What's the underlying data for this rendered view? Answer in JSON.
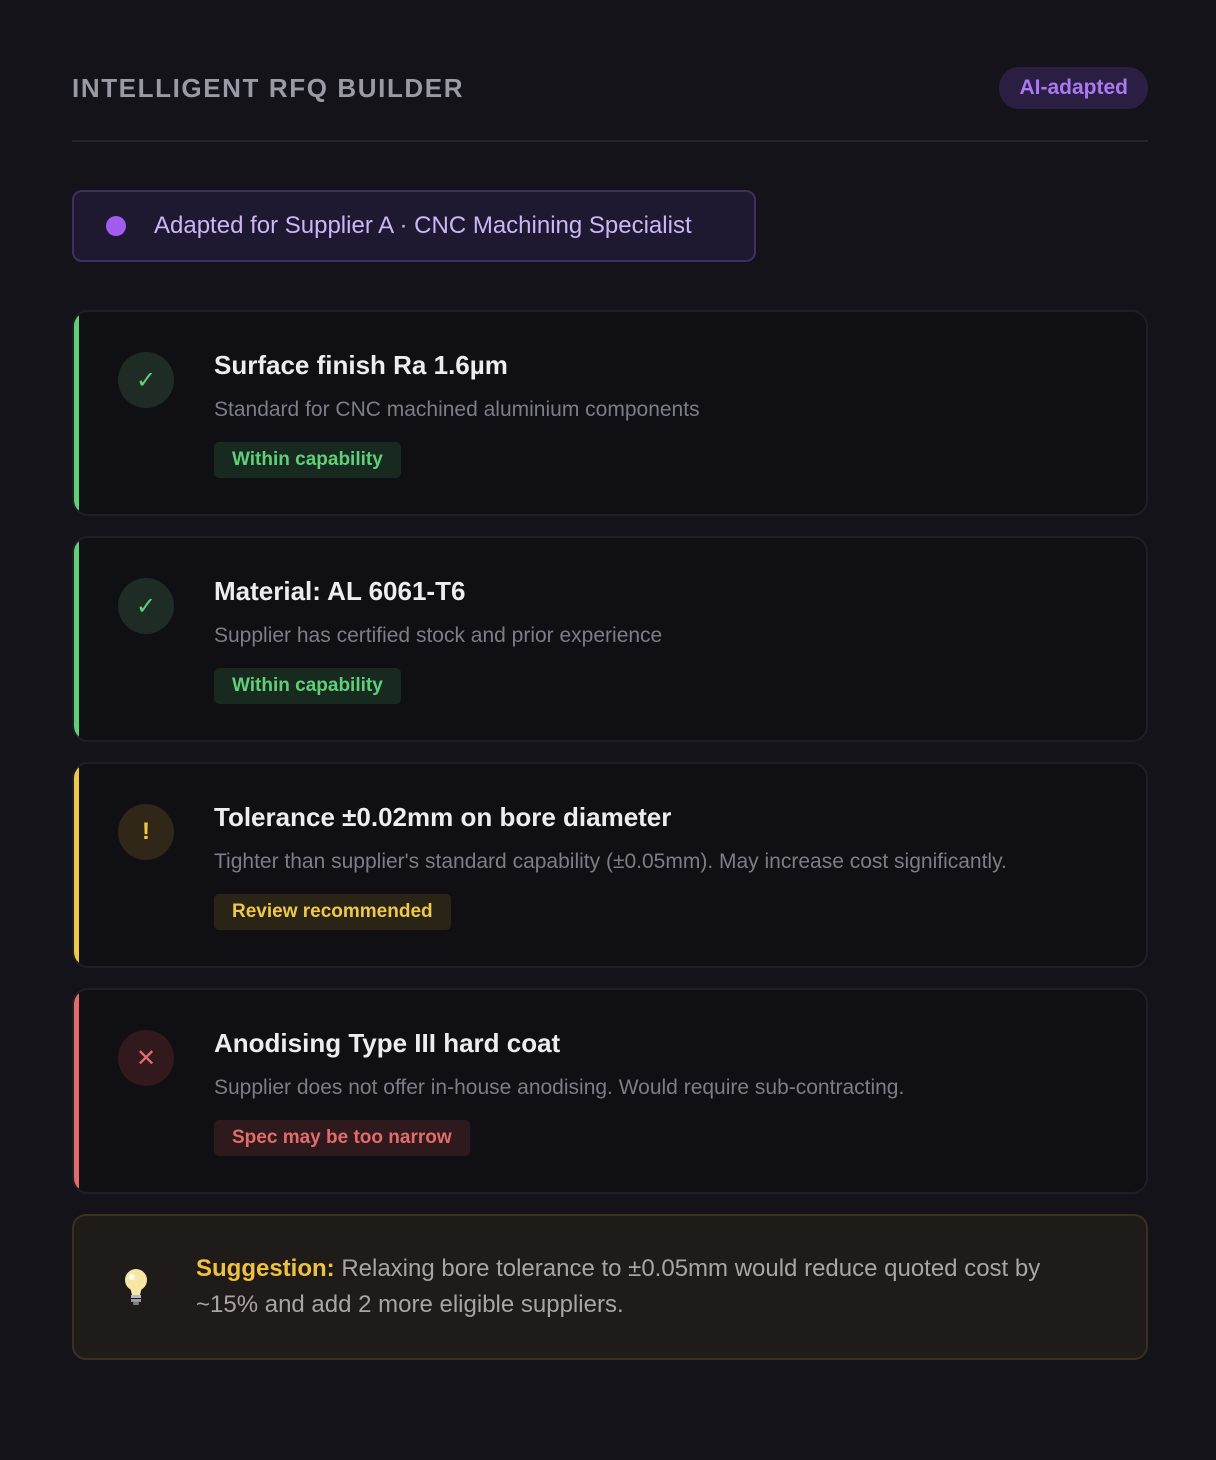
{
  "header": {
    "title": "INTELLIGENT RFQ BUILDER",
    "badge": "AI-adapted"
  },
  "adapted_banner": {
    "text": "Adapted for Supplier A · CNC Machining Specialist"
  },
  "specs": [
    {
      "status": "ok",
      "icon": "check-icon",
      "icon_glyph": "✓",
      "title": "Surface finish Ra 1.6µm",
      "description": "Standard for CNC machined aluminium components",
      "tag": "Within capability"
    },
    {
      "status": "ok",
      "icon": "check-icon",
      "icon_glyph": "✓",
      "title": "Material: AL 6061-T6",
      "description": "Supplier has certified stock and prior experience",
      "tag": "Within capability"
    },
    {
      "status": "warn",
      "icon": "exclamation-icon",
      "icon_glyph": "!",
      "title": "Tolerance ±0.02mm on bore diameter",
      "description": "Tighter than supplier's standard capability (±0.05mm). May increase cost significantly.",
      "tag": "Review recommended"
    },
    {
      "status": "err",
      "icon": "cross-icon",
      "icon_glyph": "✕",
      "title": "Anodising Type III hard coat",
      "description": "Supplier does not offer in-house anodising. Would require sub-contracting.",
      "tag": "Spec may be too narrow"
    }
  ],
  "suggestion": {
    "icon": "lightbulb-icon",
    "label": "Suggestion:",
    "text": " Relaxing bore tolerance to ±0.05mm would reduce quoted cost by ~15% and add 2 more eligible suppliers."
  },
  "colors": {
    "background": "#131319",
    "accent_purple": "#a35cf0",
    "ok": "#5fcf78",
    "warn": "#efc84a",
    "err": "#e46b6b"
  }
}
